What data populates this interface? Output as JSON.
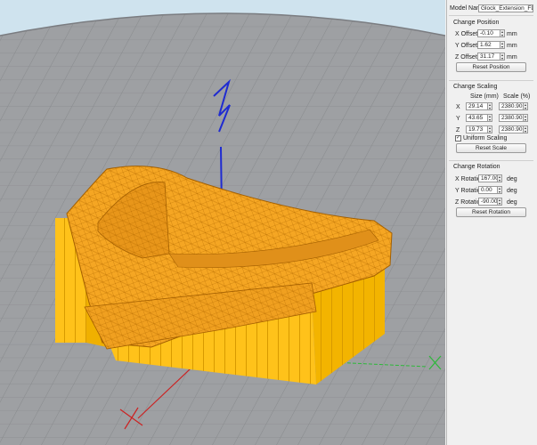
{
  "panel": {
    "model_name_label": "Model Name:",
    "model_name_value": "Glock_Extension_FDI_D",
    "position": {
      "title": "Change Position",
      "x_label": "X Offset",
      "x_value": "-0.10",
      "x_unit": "mm",
      "y_label": "Y Offset",
      "y_value": "1.62",
      "y_unit": "mm",
      "z_label": "Z Offset",
      "z_value": "31.17",
      "z_unit": "mm",
      "reset_label": "Reset Position"
    },
    "scaling": {
      "title": "Change Scaling",
      "size_header": "Size (mm)",
      "scale_header": "Scale (%)",
      "rows": [
        {
          "axis": "X",
          "size": "29.14",
          "scale": "2380.90"
        },
        {
          "axis": "Y",
          "size": "43.65",
          "scale": "2380.90"
        },
        {
          "axis": "Z",
          "size": "19.73",
          "scale": "2380.90"
        }
      ],
      "uniform_label": "Uniform Scaling",
      "uniform_checked": true,
      "reset_label": "Reset Scale"
    },
    "rotation": {
      "title": "Change Rotation",
      "x_label": "X Rotation",
      "x_value": "167.00",
      "x_unit": "deg",
      "y_label": "Y Rotation",
      "y_value": "0.00",
      "y_unit": "deg",
      "z_label": "Z Rotation",
      "z_value": "-90.00",
      "z_unit": "deg",
      "reset_label": "Reset Rotation"
    }
  },
  "viewport": {
    "model_color": "#f5a623",
    "support_color": "#ffc21a",
    "bed_color": "#9ea0a3",
    "sky_color": "#cfe3ee"
  }
}
